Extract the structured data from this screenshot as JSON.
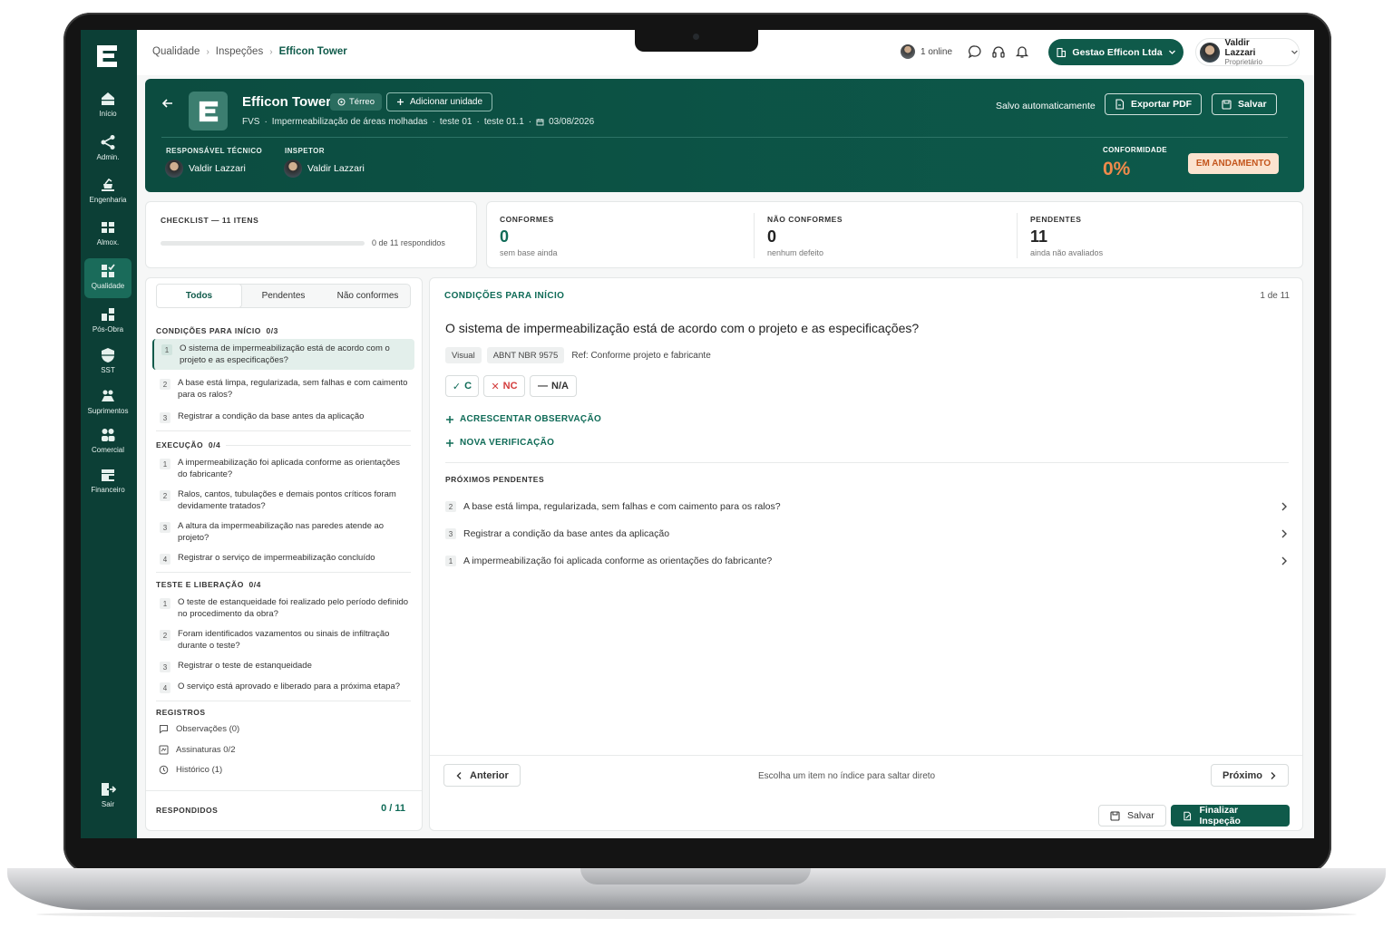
{
  "sidebar": {
    "items": [
      {
        "label": "Início",
        "icon": "home-icon"
      },
      {
        "label": "Admin.",
        "icon": "share-icon"
      },
      {
        "label": "Engenharia",
        "icon": "engineering-icon"
      },
      {
        "label": "Almox.",
        "icon": "warehouse-icon"
      },
      {
        "label": "Qualidade",
        "icon": "quality-check-icon",
        "active": true
      },
      {
        "label": "Pós-Obra",
        "icon": "post-work-icon"
      },
      {
        "label": "SST",
        "icon": "shield-icon"
      },
      {
        "label": "Suprimentos",
        "icon": "supplies-icon"
      },
      {
        "label": "Comercial",
        "icon": "people-icon"
      },
      {
        "label": "Financeiro",
        "icon": "wallet-icon"
      }
    ],
    "logout_label": "Sair"
  },
  "topbar": {
    "breadcrumb": [
      "Qualidade",
      "Inspeções",
      "Efficon Tower"
    ],
    "online_text": "1 online",
    "company_label": "Gestao Efficon Ltda",
    "user_name": "Valdir Lazzari",
    "user_role": "Proprietário"
  },
  "header": {
    "title": "Efficon Tower",
    "location_tag": "Térreo",
    "add_unit_label": "Adicionar unidade",
    "sub_type": "FVS",
    "sub_service": "Impermeabilização de áreas molhadas",
    "sub_unit1": "teste 01",
    "sub_unit2": "teste 01.1",
    "sub_date": "03/08/2026",
    "resp_label": "RESPONSÁVEL TÉCNICO",
    "resp_name": "Valdir Lazzari",
    "insp_label": "INSPETOR",
    "insp_name": "Valdir Lazzari",
    "autosave_text": "Salvo automaticamente",
    "export_label": "Exportar PDF",
    "save_label": "Salvar",
    "conformity_label": "CONFORMIDADE",
    "conformity_value": "0%",
    "status_badge": "EM ANDAMENTO"
  },
  "stats": {
    "checklist_label": "CHECKLIST — 11 ITENS",
    "progress_fraction": 0,
    "progress_text": "0 de 11 respondidos",
    "conformes": {
      "label": "CONFORMES",
      "value": "0",
      "note": "sem base ainda"
    },
    "nao_conformes": {
      "label": "NÃO CONFORMES",
      "value": "0",
      "note": "nenhum defeito"
    },
    "pendentes": {
      "label": "PENDENTES",
      "value": "11",
      "note": "ainda não avaliados"
    }
  },
  "checklist": {
    "tabs": [
      "Todos",
      "Pendentes",
      "Não conformes"
    ],
    "sections": [
      {
        "title": "CONDIÇÕES PARA INÍCIO",
        "count": "0/3",
        "items": [
          {
            "n": "1",
            "text": "O sistema de impermeabilização está de acordo com o projeto e as especificações?"
          },
          {
            "n": "2",
            "text": "A base está limpa, regularizada, sem falhas e com caimento para os ralos?"
          },
          {
            "n": "3",
            "text": "Registrar a condição da base antes da aplicação"
          }
        ]
      },
      {
        "title": "EXECUÇÃO",
        "count": "0/4",
        "items": [
          {
            "n": "1",
            "text": "A impermeabilização foi aplicada conforme as orientações do fabricante?"
          },
          {
            "n": "2",
            "text": "Ralos, cantos, tubulações e demais pontos críticos foram devidamente tratados?"
          },
          {
            "n": "3",
            "text": "A altura da impermeabilização nas paredes atende ao projeto?"
          },
          {
            "n": "4",
            "text": "Registrar o serviço de impermeabilização concluído"
          }
        ]
      },
      {
        "title": "TESTE E LIBERAÇÃO",
        "count": "0/4",
        "items": [
          {
            "n": "1",
            "text": "O teste de estanqueidade foi realizado pelo período definido no procedimento da obra?"
          },
          {
            "n": "2",
            "text": "Foram identificados vazamentos ou sinais de infiltração durante o teste?"
          },
          {
            "n": "3",
            "text": "Registrar o teste de estanqueidade"
          },
          {
            "n": "4",
            "text": "O serviço está aprovado e liberado para a próxima etapa?"
          }
        ]
      }
    ],
    "registros_title": "REGISTROS",
    "registros": [
      "Observações (0)",
      "Assinaturas 0/2",
      "Histórico (1)"
    ],
    "answered_label": "RESPONDIDOS",
    "answered_value": "0 / 11"
  },
  "main": {
    "section_title": "CONDIÇÕES PARA INÍCIO",
    "position": "1 de 11",
    "question": "O sistema de impermeabilização está de acordo com o projeto e as especificações?",
    "tags": [
      "Visual",
      "ABNT NBR 9575"
    ],
    "reference": "Ref: Conforme projeto e fabricante",
    "answers": {
      "c": "C",
      "nc": "NC",
      "na": "N/A"
    },
    "add_observation": "ACRESCENTAR OBSERVAÇÃO",
    "new_verification": "NOVA VERIFICAÇÃO",
    "next_pending_title": "PRÓXIMOS PENDENTES",
    "next_pending": [
      {
        "n": "2",
        "text": "A base está limpa, regularizada, sem falhas e com caimento para os ralos?"
      },
      {
        "n": "3",
        "text": "Registrar a condição da base antes da aplicação"
      },
      {
        "n": "1",
        "text": "A impermeabilização foi aplicada conforme as orientações do fabricante?"
      }
    ],
    "prev_label": "Anterior",
    "hint": "Escolha um item no índice para saltar direto",
    "next_label": "Próximo",
    "save_label": "Salvar",
    "finalize_label": "Finalizar Inspeção"
  },
  "colors": {
    "brand": "#0f5a4a",
    "sidebar": "#0c3f36",
    "accent_orange": "#f08a4b",
    "badge_bg": "#fbe3cf"
  }
}
